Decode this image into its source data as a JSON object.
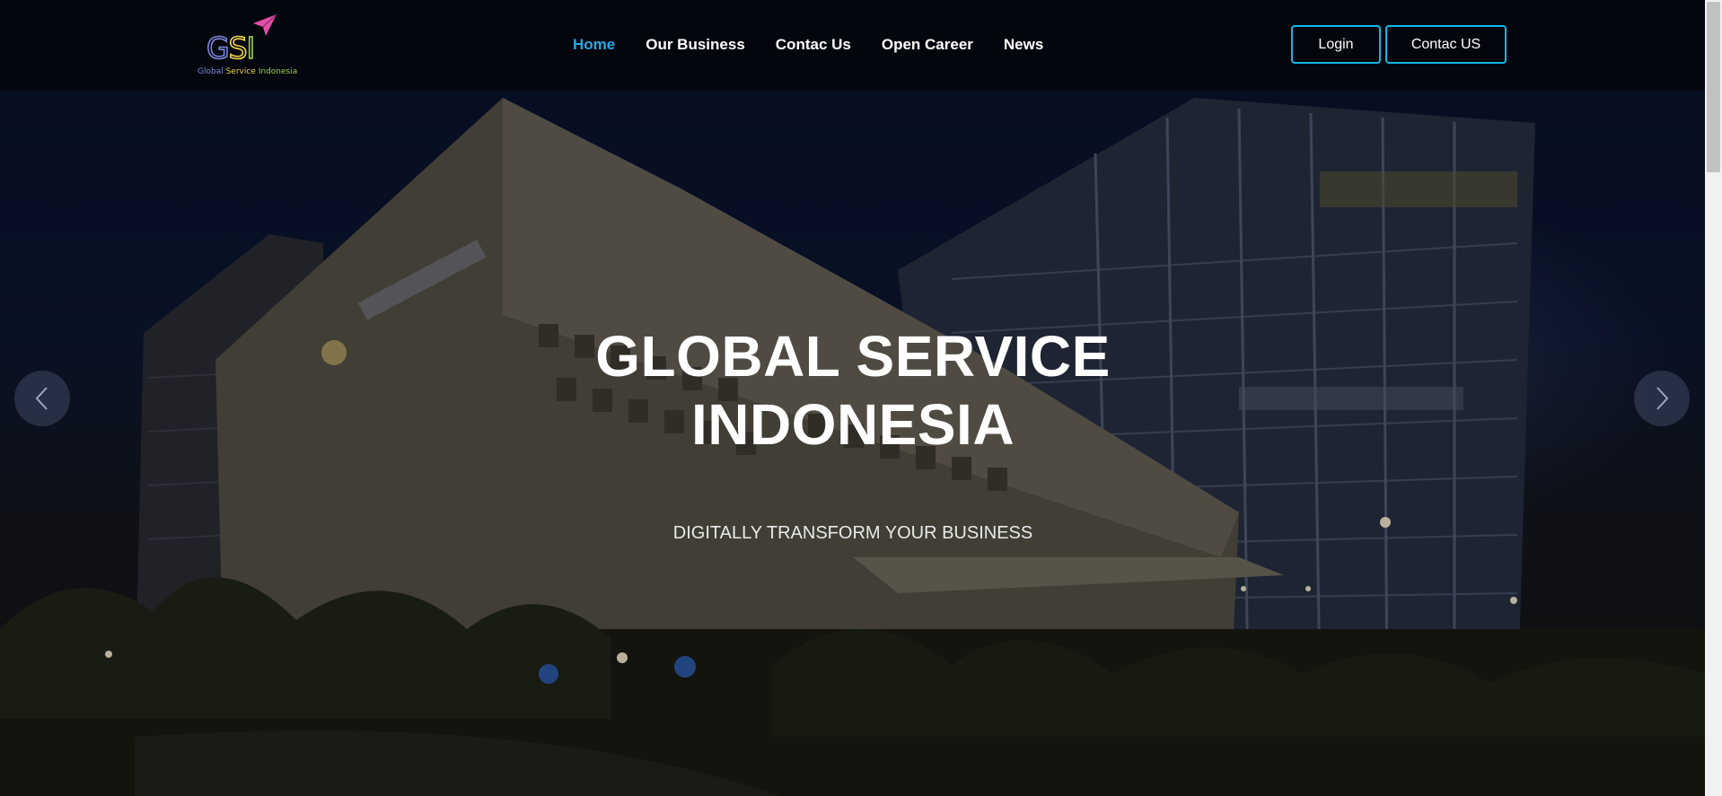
{
  "header": {
    "logo": {
      "mark": [
        "G",
        "S",
        "I"
      ],
      "tagline": [
        "Global",
        "Service",
        "Indonesia"
      ],
      "icon": "paper-plane-icon"
    },
    "nav": [
      {
        "label": "Home",
        "active": true
      },
      {
        "label": "Our Business",
        "active": false
      },
      {
        "label": "Contac Us",
        "active": false
      },
      {
        "label": "Open Career",
        "active": false
      },
      {
        "label": "News",
        "active": false
      }
    ],
    "login_label": "Login",
    "contact_label": "Contac US"
  },
  "hero": {
    "title_line1": "GLOBAL SERVICE",
    "title_line2": "INDONESIA",
    "subtitle": "DIGITALLY TRANSFORM YOUR BUSINESS",
    "prev_icon": "chevron-left-icon",
    "next_icon": "chevron-right-icon"
  },
  "colors": {
    "header_bg": "#03060d",
    "accent": "#2ba6e0",
    "button_border": "#14b8e6",
    "text": "#ffffff"
  }
}
